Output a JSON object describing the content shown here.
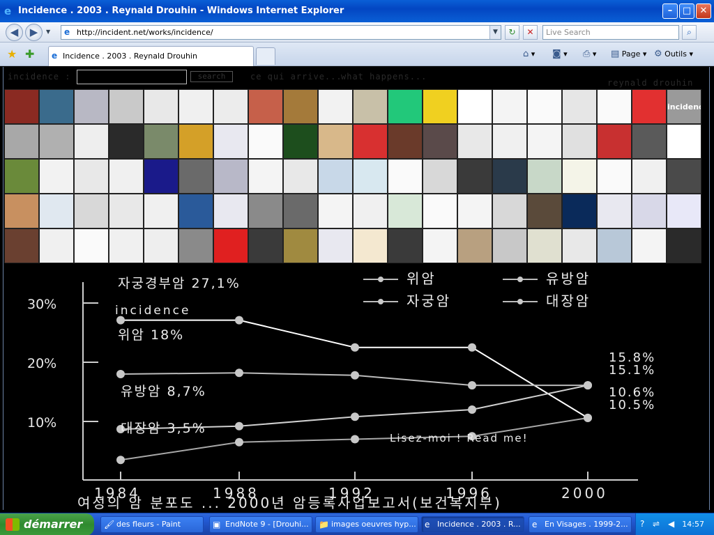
{
  "window": {
    "title": "Incidence . 2003 . Reynald Drouhin - Windows Internet Explorer",
    "minimize": "–",
    "maximize": "□",
    "close": "✕"
  },
  "nav": {
    "back_icon": "◀",
    "forward_icon": "▶",
    "dropdown_icon": "▼",
    "url": "http://incident.net/works/incidence/",
    "refresh_icon": "↻",
    "stop_icon": "✕",
    "search_placeholder": "Live Search",
    "search_icon": "⌕"
  },
  "tabs": {
    "active_label": "Incidence . 2003 . Reynald Drouhin",
    "commands": {
      "page": "Page",
      "tools": "Outils"
    }
  },
  "site": {
    "label": "incidence :",
    "search_button": "search",
    "link_fr": "ce qui arrive...",
    "link_en": "what happens...",
    "author": "reynald drouhin",
    "logo_thumb": "incidence"
  },
  "thumb_colors": [
    "#8a2a22",
    "#3a6b8c",
    "#b8b8c4",
    "#c9c9c9",
    "#e8e8e8",
    "#f0f0f0",
    "#ececec",
    "#c6604a",
    "#a47a3a",
    "#f2f2f2",
    "#c8c0a8",
    "#22c87a",
    "#f0d020",
    "#ffffff",
    "#f4f4f4",
    "#fafafa",
    "#e6e6e6",
    "#fafafa",
    "#e23030",
    "#9a9a9a",
    "#a8a8a8",
    "#b0b0b0",
    "#eeeeee",
    "#2a2a2a",
    "#7a8a6a",
    "#d4a028",
    "#e8e8f0",
    "#fafafa",
    "#1d4e1d",
    "#d8b88a",
    "#d83030",
    "#6a3a2a",
    "#5a4a4a",
    "#e8e8e8",
    "#f0f0f0",
    "#f4f4f4",
    "#e0e0e0",
    "#c83030",
    "#5a5a5a",
    "#ffffff",
    "#6a8a3a",
    "#f2f2f2",
    "#e8e8e8",
    "#f0f0f0",
    "#1a1a8a",
    "#6a6a6a",
    "#b8b8c8",
    "#f4f4f4",
    "#e8e8e8",
    "#c8d8e8",
    "#d8e8f0",
    "#fafafa",
    "#d8d8d8",
    "#3a3a3a",
    "#2a3a4a",
    "#c8d8c8",
    "#f4f4e8",
    "#fafafa",
    "#f0f0f0",
    "#4a4a4a",
    "#c89060",
    "#e0e8f0",
    "#d8d8d8",
    "#e8e8e8",
    "#f0f0f0",
    "#2a5a9a",
    "#e8e8f0",
    "#8a8a8a",
    "#6a6a6a",
    "#f4f4f4",
    "#f0f0f0",
    "#d8e8d8",
    "#fafafa",
    "#f4f4f4",
    "#d8d8d8",
    "#5a4a3a",
    "#0a2a5a",
    "#e8e8f0",
    "#d8d8e8",
    "#e8e8f8",
    "#6a4030",
    "#f0f0f0",
    "#fafafa",
    "#f0f0f0",
    "#eeeeee",
    "#8a8a8a",
    "#e02020",
    "#3a3a3a",
    "#a08a40",
    "#e8e8f0",
    "#f4e8d0",
    "#3a3a3a",
    "#f4f4f4",
    "#b8a080",
    "#c8c8c8",
    "#e0e0d0",
    "#e8e8e8",
    "#b8c8d8",
    "#f4f4f4",
    "#2a2a2a"
  ],
  "chart_data": {
    "type": "line",
    "x": [
      "1984",
      "1988",
      "1992",
      "1996",
      "2000"
    ],
    "ylabels": [
      "30%",
      "20%",
      "10%"
    ],
    "ylim": [
      0,
      30
    ],
    "legend": [
      "위암",
      "유방암",
      "자궁암",
      "대장암"
    ],
    "series": [
      {
        "name": "자궁경부암",
        "values": [
          27.1,
          27.1,
          22.5,
          22.5,
          10.6
        ],
        "label": "자궁경부암 27,1%",
        "end_label": "10.6%"
      },
      {
        "name": "위암",
        "values": [
          18,
          18.2,
          17.8,
          16.1,
          16.1
        ],
        "label": "위암 18%",
        "end_label": "15.8%"
      },
      {
        "name": "유방암",
        "values": [
          8.7,
          9.2,
          10.8,
          12.0,
          16.1
        ],
        "label": "유방암 8,7%",
        "end_label": "15.1%"
      },
      {
        "name": "대장암",
        "values": [
          3.5,
          6.5,
          7.0,
          7.5,
          10.6
        ],
        "label": "대장암 3,5%",
        "end_label": "10.5%"
      }
    ],
    "annotation_incidence": "incidence",
    "annotation_readme": "Lisez-moi ! Read me!",
    "caption": "여성의 암 분포도 ... 2000년 암등록사업보고서(보건복지부)"
  },
  "taskbar": {
    "start": "démarrer",
    "tasks": [
      {
        "label": "des fleurs - Paint",
        "icon": "🖌"
      },
      {
        "label": "EndNote 9 - [Drouhi...",
        "icon": "▣"
      },
      {
        "label": "images oeuvres hyp...",
        "icon": "📁"
      },
      {
        "label": "Incidence . 2003 . R...",
        "icon": "e"
      },
      {
        "label": "En Visages . 1999-2...",
        "icon": "e"
      }
    ],
    "clock": "14:57"
  }
}
